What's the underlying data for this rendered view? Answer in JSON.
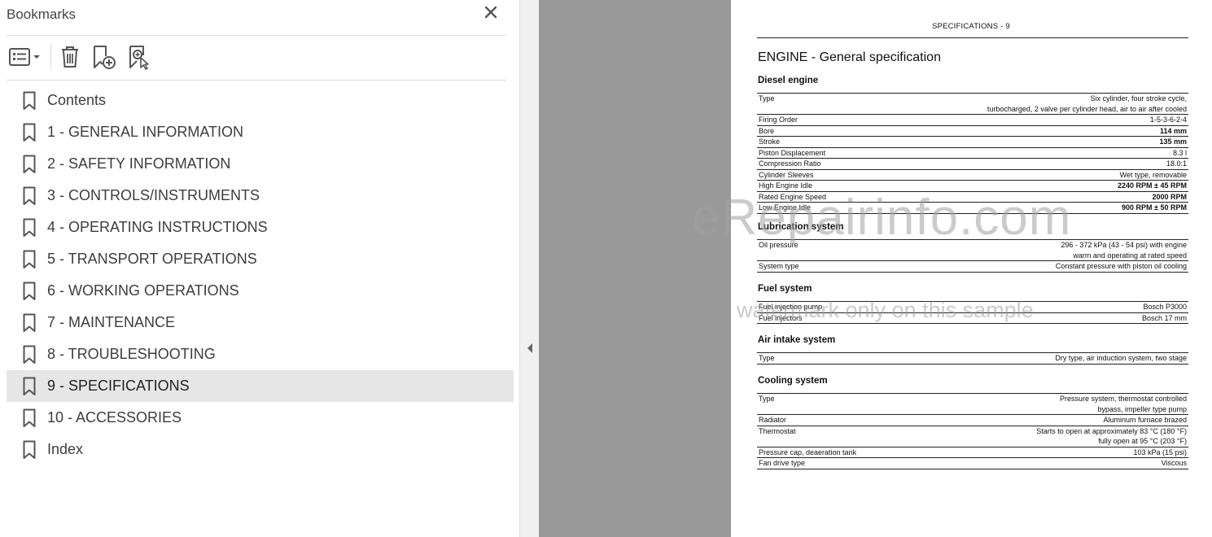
{
  "bookmarks_panel": {
    "title": "Bookmarks",
    "toolbar": {
      "options_icon": "list-options-icon",
      "delete_icon": "trash-icon",
      "new_icon": "add-bookmark-icon",
      "search_icon": "find-bookmark-icon"
    },
    "items": [
      {
        "label": "Contents"
      },
      {
        "label": "1 - GENERAL INFORMATION"
      },
      {
        "label": "2 - SAFETY INFORMATION"
      },
      {
        "label": "3 - CONTROLS/INSTRUMENTS"
      },
      {
        "label": "4 - OPERATING INSTRUCTIONS"
      },
      {
        "label": "5 - TRANSPORT OPERATIONS"
      },
      {
        "label": "6 - WORKING OPERATIONS"
      },
      {
        "label": "7 - MAINTENANCE"
      },
      {
        "label": "8 - TROUBLESHOOTING"
      },
      {
        "label": "9 - SPECIFICATIONS",
        "selected": true
      },
      {
        "label": "10 - ACCESSORIES"
      },
      {
        "label": "Index"
      }
    ]
  },
  "document": {
    "header": "SPECIFICATIONS - 9",
    "title": "ENGINE - General specification",
    "sections": [
      {
        "title": "Diesel engine",
        "rows": [
          {
            "name": "Type",
            "value": [
              "Six cylinder, four stroke cycle,",
              "turbocharged, 2 valve per cylinder head, air to air after cooled"
            ]
          },
          {
            "name": "Firing Order",
            "value": [
              "1-5-3-6-2-4"
            ]
          },
          {
            "name": "Bore",
            "value": [
              "114 mm"
            ],
            "bold": true
          },
          {
            "name": "Stroke",
            "value": [
              "135 mm"
            ],
            "bold": true
          },
          {
            "name": "Piston Displacement",
            "value": [
              "8.3 l"
            ]
          },
          {
            "name": "Compression Ratio",
            "value": [
              "18.0:1"
            ]
          },
          {
            "name": "Cylinder Sleeves",
            "value": [
              "Wet type, removable"
            ]
          },
          {
            "name": "High Engine Idle",
            "value": [
              "2240 RPM ± 45 RPM"
            ],
            "bold": true
          },
          {
            "name": "Rated Engine Speed",
            "value": [
              "2000 RPM"
            ],
            "bold": true
          },
          {
            "name": "Low Engine Idle",
            "value": [
              "900 RPM ± 50 RPM"
            ],
            "bold": true
          }
        ]
      },
      {
        "title": "Lubrication system",
        "rows": [
          {
            "name": "Oil pressure",
            "value": [
              "296 - 372 kPa (43 - 54 psi) with engine",
              "warm and operating at rated speed"
            ]
          },
          {
            "name": "System type",
            "value": [
              "Constant pressure with piston oil cooling"
            ]
          }
        ]
      },
      {
        "title": "Fuel system",
        "rows": [
          {
            "name": "Fuel injection pump",
            "value": [
              "Bosch P3000"
            ]
          },
          {
            "name": "Fuel injectors",
            "value": [
              "Bosch 17 mm"
            ]
          }
        ]
      },
      {
        "title": "Air intake system",
        "rows": [
          {
            "name": "Type",
            "value": [
              "Dry type, air induction system, two stage"
            ]
          }
        ]
      },
      {
        "title": "Cooling system",
        "rows": [
          {
            "name": "Type",
            "value": [
              "Pressure system, thermostat controlled",
              "bypass, impeller type pump"
            ]
          },
          {
            "name": "Radiator",
            "value": [
              "Aluminum furnace brazed"
            ]
          },
          {
            "name": "Thermostat",
            "value": [
              "Starts to open at approximately 83 °C (180 °F)",
              "fully open at 95 °C (203 °F)"
            ]
          },
          {
            "name": "Pressure cap, deaeration tank",
            "value": [
              "103 kPa (15 psi)"
            ]
          },
          {
            "name": "Fan drive type",
            "value": [
              "Viscous"
            ]
          }
        ]
      }
    ],
    "watermark": "eRepairinfo.com",
    "watermark_sub": "watermark only on this sample"
  }
}
